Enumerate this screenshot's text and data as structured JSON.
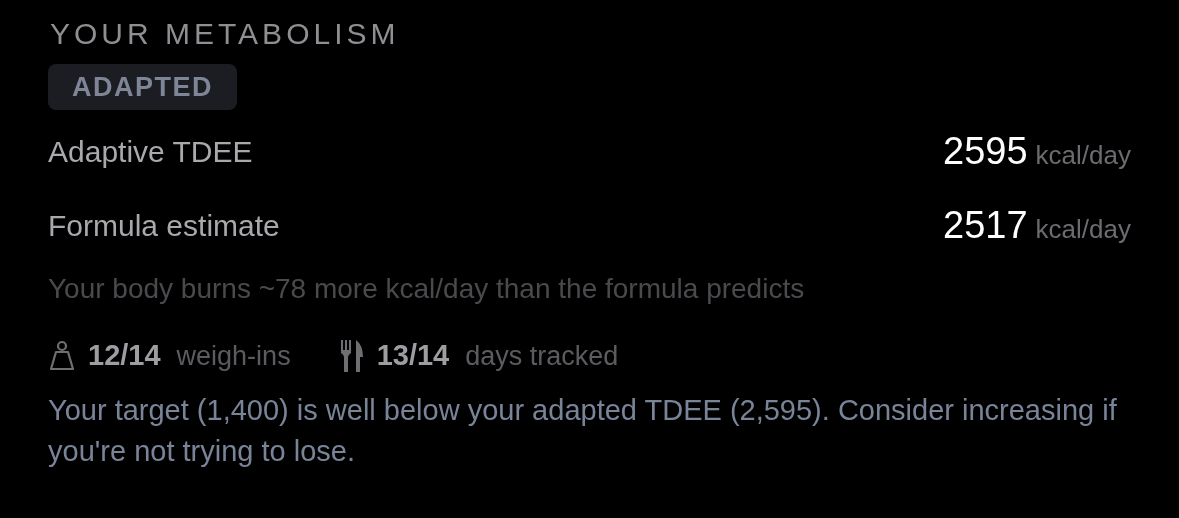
{
  "section_title": "YOUR METABOLISM",
  "status_badge": "ADAPTED",
  "metrics": [
    {
      "label": "Adaptive TDEE",
      "value": "2595",
      "unit": "kcal/day"
    },
    {
      "label": "Formula estimate",
      "value": "2517",
      "unit": "kcal/day"
    }
  ],
  "comparison_note": "Your body burns ~78 more kcal/day than the formula predicts",
  "stats": [
    {
      "kind": "weight",
      "count": "12/14",
      "label": "weigh-ins"
    },
    {
      "kind": "meals",
      "count": "13/14",
      "label": "days tracked"
    }
  ],
  "warning": "Your target (1,400) is well below your adapted TDEE (2,595). Consider increasing if you're not trying to lose."
}
